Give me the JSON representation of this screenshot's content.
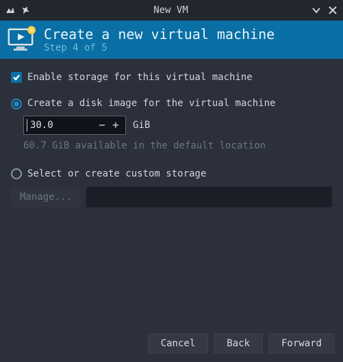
{
  "window": {
    "title": "New VM"
  },
  "header": {
    "title": "Create a new virtual machine",
    "step_label": "Step 4 of 5"
  },
  "storage": {
    "enable_label": "Enable storage for this virtual machine",
    "enable_checked": true,
    "create_image": {
      "label": "Create a disk image for the virtual machine",
      "selected": true,
      "size_value": "30.0",
      "unit": "GiB",
      "available_hint": "60.7 GiB available in the default location"
    },
    "custom": {
      "label": "Select or create custom storage",
      "selected": false,
      "manage_label": "Manage...",
      "path_value": ""
    }
  },
  "footer": {
    "cancel": "Cancel",
    "back": "Back",
    "forward": "Forward"
  }
}
